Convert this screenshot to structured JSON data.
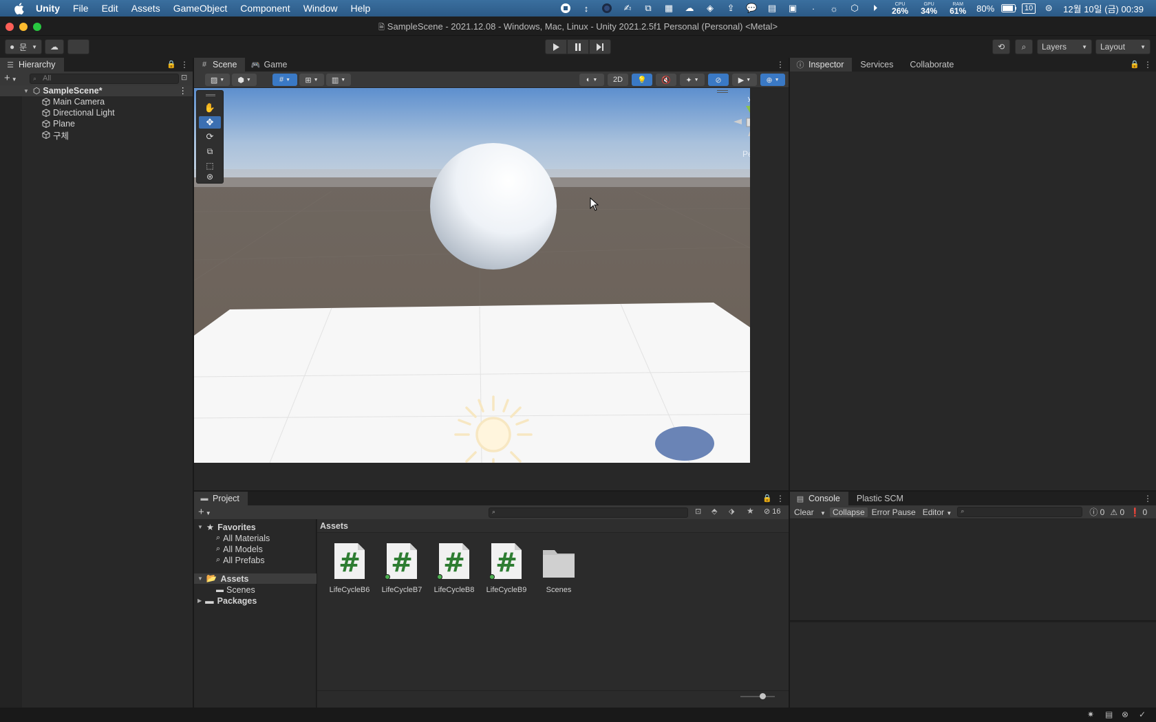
{
  "menubar": {
    "app": "Unity",
    "items": [
      "File",
      "Edit",
      "Assets",
      "GameObject",
      "Component",
      "Window",
      "Help"
    ],
    "cpu": {
      "label": "CPU",
      "value": "26%"
    },
    "gpu": {
      "label": "GPU",
      "value": "34%"
    },
    "ram": {
      "label": "RAM",
      "value": "61%"
    },
    "battery": "80%",
    "calendar_day": "10",
    "clock": "12월 10일 (금)  00:39"
  },
  "window": {
    "title": "SampleScene - 2021.12.08 - Windows, Mac, Linux - Unity 2021.2.5f1 Personal (Personal) <Metal>"
  },
  "toolbar": {
    "account_label": "문",
    "layers_label": "Layers",
    "layout_label": "Layout"
  },
  "hierarchy": {
    "tab": "Hierarchy",
    "search_placeholder": "All",
    "scene": "SampleScene*",
    "objects": [
      "Main Camera",
      "Directional Light",
      "Plane",
      "구체"
    ]
  },
  "scene": {
    "tabs": [
      "Scene",
      "Game"
    ],
    "mode_2d": "2D",
    "persp": "Persp",
    "gizmo_y": "y",
    "gizmo_x": "x"
  },
  "inspector": {
    "tabs": [
      "Inspector",
      "Services",
      "Collaborate"
    ]
  },
  "project": {
    "tab": "Project",
    "hidden_count": "16",
    "favorites_label": "Favorites",
    "favorites": [
      "All Materials",
      "All Models",
      "All Prefabs"
    ],
    "assets_label": "Assets",
    "assets_children": [
      "Scenes"
    ],
    "packages_label": "Packages",
    "breadcrumb": "Assets",
    "items": [
      {
        "name": "LifeCycleB6",
        "type": "script"
      },
      {
        "name": "LifeCycleB7",
        "type": "script"
      },
      {
        "name": "LifeCycleB8",
        "type": "script"
      },
      {
        "name": "LifeCycleB9",
        "type": "script"
      },
      {
        "name": "Scenes",
        "type": "folder"
      }
    ]
  },
  "console": {
    "tabs": [
      "Console",
      "Plastic SCM"
    ],
    "clear": "Clear",
    "collapse": "Collapse",
    "error_pause": "Error Pause",
    "editor": "Editor",
    "log_count": "0",
    "warn_count": "0",
    "error_count": "0"
  },
  "colors": {
    "menubar": "#2c5a86",
    "panel_bg": "#282828",
    "tab_active": "#383838",
    "accent_blue": "#3a79c5",
    "script_hash": "#2e7d32"
  }
}
